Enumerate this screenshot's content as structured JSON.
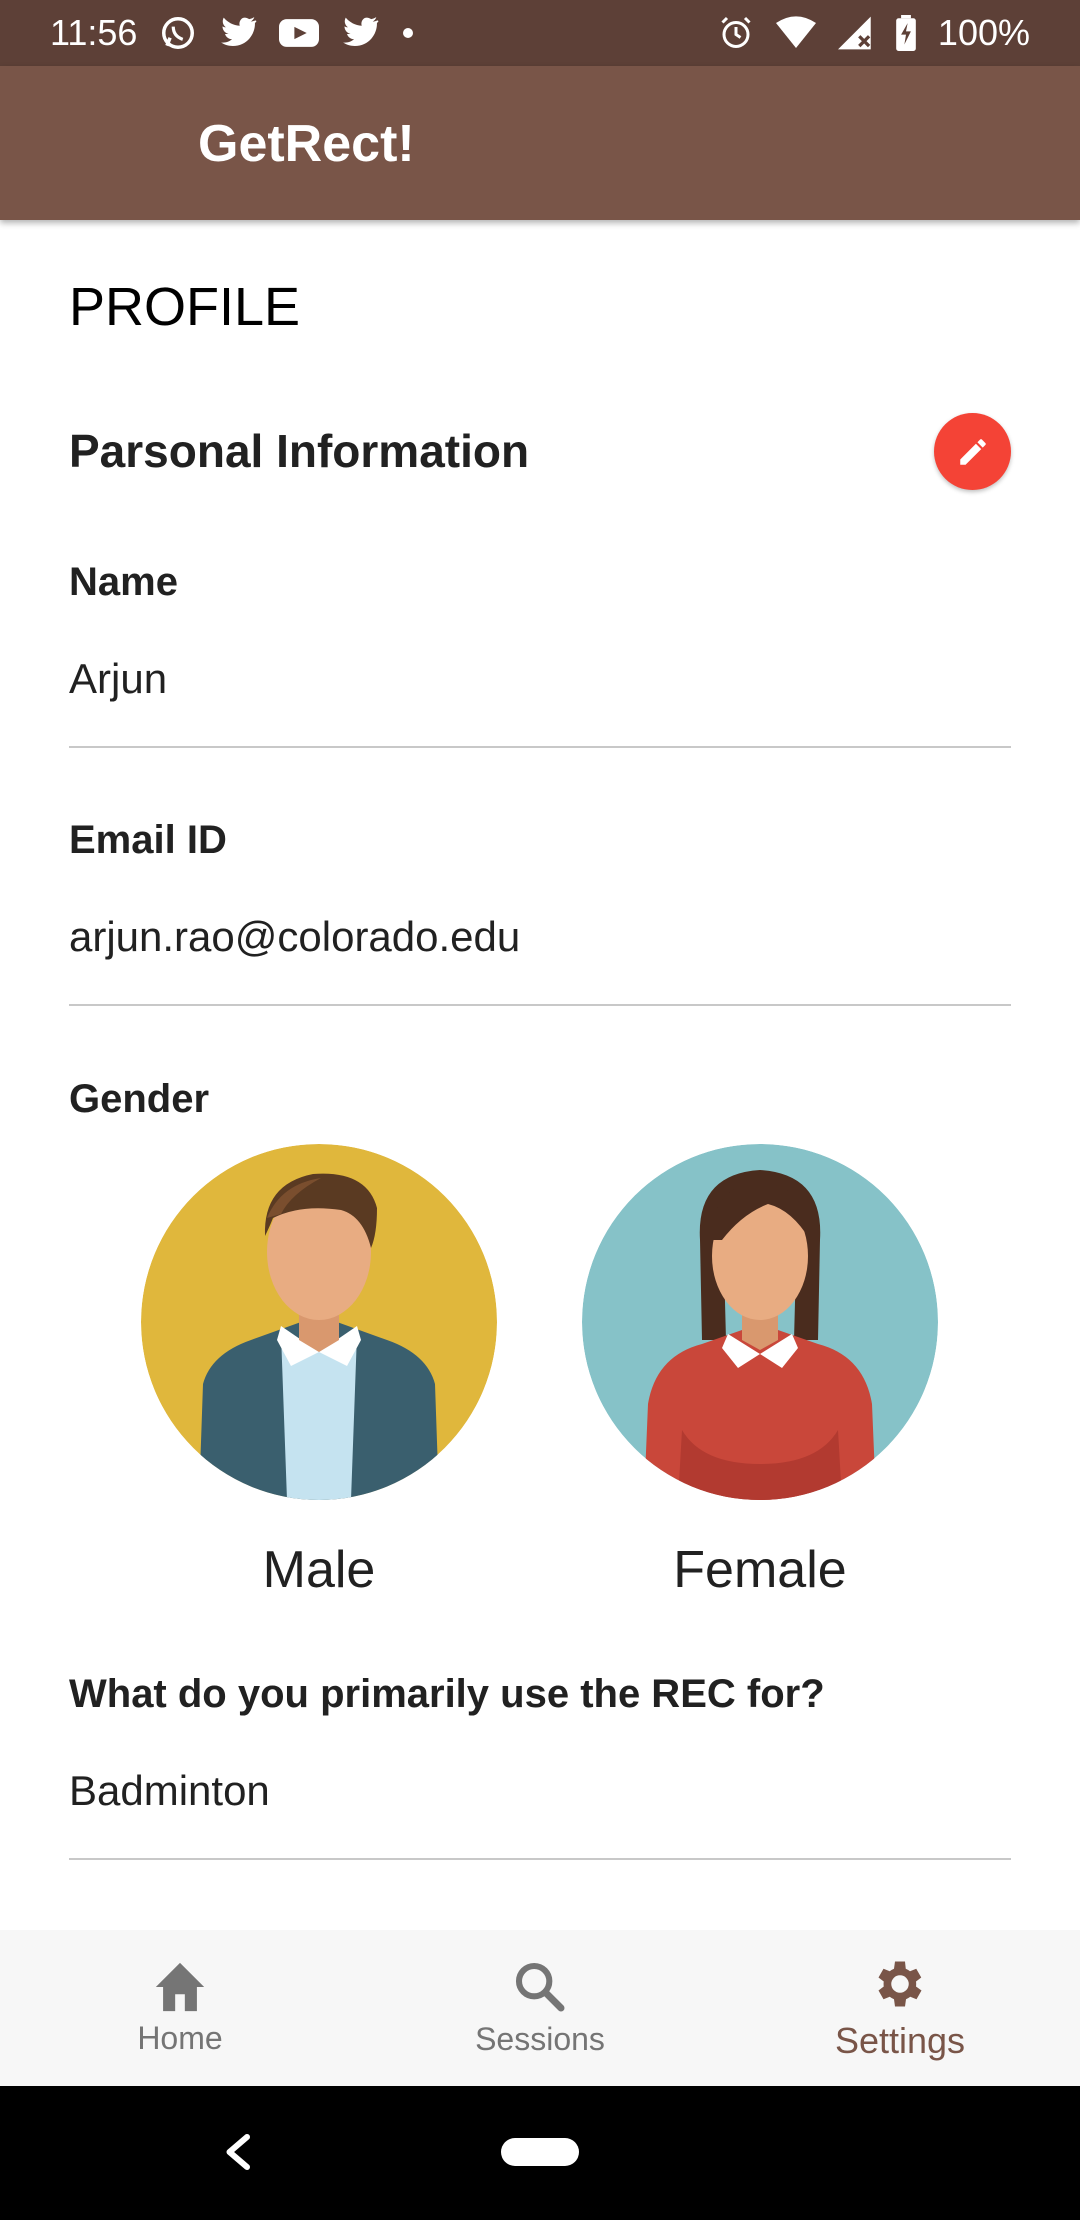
{
  "status_bar": {
    "time": "11:56",
    "battery": "100%",
    "left_icons": [
      "whatsapp-icon",
      "twitter-icon",
      "youtube-icon",
      "twitter-icon",
      "dot-icon"
    ],
    "right_icons": [
      "alarm-icon",
      "wifi-icon",
      "signal-icon",
      "battery-icon"
    ]
  },
  "app_bar": {
    "title": "GetRect!"
  },
  "page": {
    "title": "PROFILE",
    "section_title": "Parsonal Information",
    "edit_icon": "pencil-icon"
  },
  "fields": {
    "name": {
      "label": "Name",
      "value": "Arjun"
    },
    "email": {
      "label": "Email ID",
      "value": "arjun.rao@colorado.edu"
    },
    "gender": {
      "label": "Gender",
      "options": [
        {
          "label": "Male",
          "color": "#e0b73c"
        },
        {
          "label": "Female",
          "color": "#86c2c8"
        }
      ]
    },
    "rec_use": {
      "label": "What do you primarily use the REC for?",
      "value": "Badminton"
    }
  },
  "bottom_nav": {
    "items": [
      {
        "label": "Home",
        "icon": "home-icon"
      },
      {
        "label": "Sessions",
        "icon": "search-icon"
      },
      {
        "label": "Settings",
        "icon": "gear-icon"
      }
    ],
    "active": "Settings"
  },
  "colors": {
    "status_bar": "#5d4037",
    "app_bar": "#795548",
    "accent": "#f44336",
    "active_nav": "#795548"
  }
}
